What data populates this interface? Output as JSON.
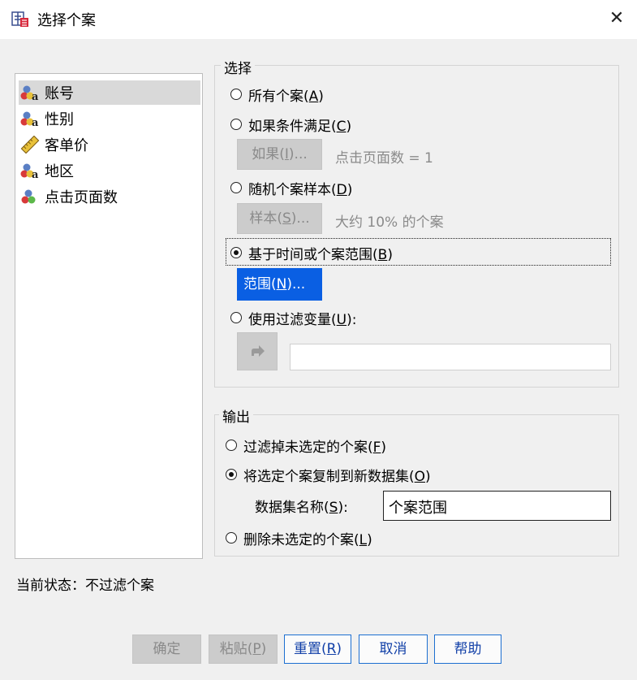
{
  "window": {
    "title": "选择个案",
    "close_label": "✕"
  },
  "variables": [
    {
      "label": "账号",
      "icon": "nominal-string-icon",
      "selected": true
    },
    {
      "label": "性别",
      "icon": "nominal-string-icon",
      "selected": false
    },
    {
      "label": "客单价",
      "icon": "scale-ruler-icon",
      "selected": false
    },
    {
      "label": "地区",
      "icon": "nominal-string-icon",
      "selected": false
    },
    {
      "label": "点击页面数",
      "icon": "nominal-numeric-icon",
      "selected": false
    }
  ],
  "select": {
    "title": "选择",
    "all_cases": {
      "text": "所有个案(",
      "key": "A",
      "suffix": ")"
    },
    "if_condition": {
      "text": "如果条件满足(",
      "key": "C",
      "suffix": ")"
    },
    "if_button": {
      "text": "如果(",
      "key": "I",
      "suffix": ")..."
    },
    "if_expression": "点击页面数 = 1",
    "random_sample": {
      "text": "随机个案样本(",
      "key": "D",
      "suffix": ")"
    },
    "sample_button": {
      "text": "样本(",
      "key": "S",
      "suffix": ")..."
    },
    "sample_description": "大约 10% 的个案",
    "range_option": {
      "text": "基于时间或个案范围(",
      "key": "B",
      "suffix": ")"
    },
    "range_button": {
      "text": "范围(",
      "key": "N",
      "suffix": ")..."
    },
    "filter_variable": {
      "text": "使用过滤变量(",
      "key": "U",
      "suffix": "):"
    },
    "filter_value": "",
    "selected_option": "range"
  },
  "output": {
    "title": "输出",
    "filter_out": {
      "text": "过滤掉未选定的个案(",
      "key": "F",
      "suffix": ")"
    },
    "copy_to_dataset": {
      "text": "将选定个案复制到新数据集(",
      "key": "O",
      "suffix": ")"
    },
    "dataset_name_label": {
      "text": "数据集名称(",
      "key": "S",
      "suffix": "):"
    },
    "dataset_name_value": "个案范围",
    "delete_unselected": {
      "text": "删除未选定的个案(",
      "key": "L",
      "suffix": ")"
    },
    "selected_option": "copy"
  },
  "status": {
    "text": "当前状态：不过滤个案"
  },
  "buttons": {
    "ok": {
      "text": "确定",
      "enabled": false
    },
    "paste": {
      "text": "粘贴(",
      "key": "P",
      "suffix": ")",
      "enabled": false
    },
    "reset": {
      "text": "重置(",
      "key": "R",
      "suffix": ")",
      "enabled": true
    },
    "cancel": {
      "text": "取消",
      "enabled": true
    },
    "help": {
      "text": "帮助",
      "enabled": true
    }
  },
  "colors": {
    "accent": "#0a5fe3",
    "dialog_bg": "#f0f0f0",
    "disabled_text": "#8a8a8a",
    "button_text": "#1240a8"
  }
}
